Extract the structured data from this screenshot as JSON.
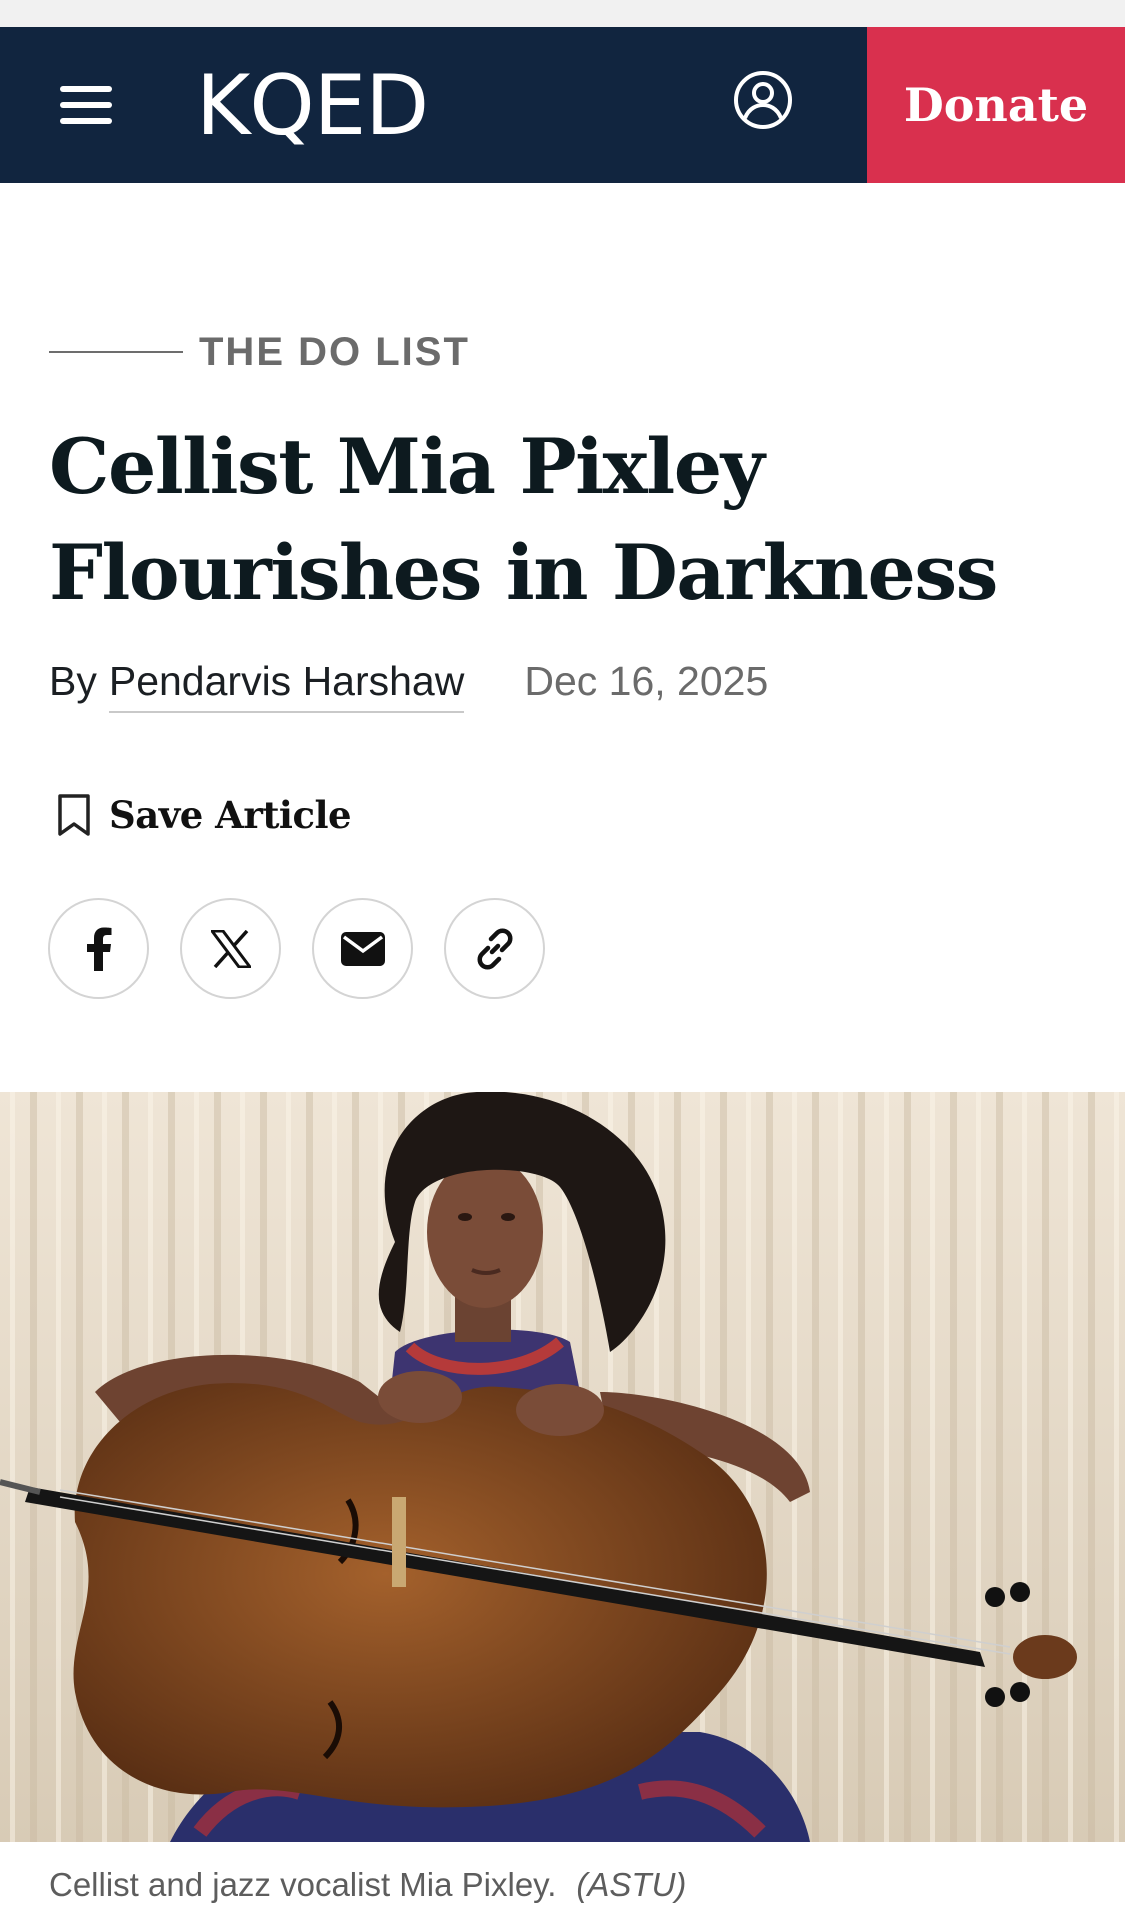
{
  "header": {
    "logo_text": "KQED",
    "donate_label": "Donate",
    "colors": {
      "background": "#11253f",
      "donate": "#d9304e"
    },
    "icons": {
      "menu": "hamburger-menu-icon",
      "account": "user-account-icon"
    }
  },
  "article": {
    "kicker": "THE DO LIST",
    "title": "Cellist Mia Pixley Flourishes in Darkness",
    "byline_prefix": "By",
    "author": "Pendarvis Harshaw",
    "date": "Dec 16, 2025",
    "save_label": "Save Article",
    "share": {
      "icons": [
        "facebook-icon",
        "x-twitter-icon",
        "email-icon",
        "copy-link-icon"
      ]
    },
    "image": {
      "subject": "woman with cello in front of beige curtain"
    },
    "caption": "Cellist and jazz vocalist Mia Pixley.",
    "credit": "(ASTU)"
  }
}
